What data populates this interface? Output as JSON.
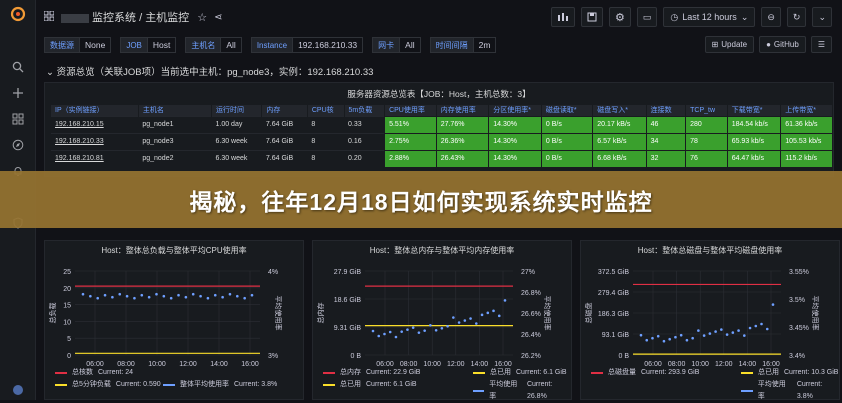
{
  "topbar": {
    "crumb_home": "",
    "crumb_suffix": "监控系统",
    "crumb_sep": "/",
    "crumb_page": "主机监控",
    "time_range": "Last 12 hours"
  },
  "vars": [
    {
      "label": "数据源",
      "value": "None"
    },
    {
      "label": "JOB",
      "value": "Host"
    },
    {
      "label": "主机名",
      "value": "All"
    },
    {
      "label": "Instance",
      "value": "192.168.210.33"
    },
    {
      "label": "网卡",
      "value": "All"
    },
    {
      "label": "时间间隔",
      "value": "2m"
    }
  ],
  "buttons": {
    "update": "Update",
    "github": "GitHub"
  },
  "section_title": "资源总览（关联JOB项）当前选中主机：pg_node3，实例：192.168.210.33",
  "table": {
    "title": "服务器资源总览表【JOB：Host，主机总数：3】",
    "headers": [
      "IP（实例链接）",
      "主机名",
      "运行时间",
      "内存",
      "CPU核",
      "5m负载",
      "CPU使用率",
      "内存使用率",
      "分区使用率*",
      "磁盘读取*",
      "磁盘写入*",
      "连接数",
      "TCP_tw",
      "下载带宽*",
      "上传带宽*"
    ],
    "rows": [
      [
        "192.168.210.15",
        "pg_node1",
        "1.00 day",
        "7.64 GiB",
        "8",
        "0.33",
        "5.51%",
        "27.76%",
        "14.30%",
        "0 B/s",
        "20.17 kB/s",
        "46",
        "280",
        "184.54 kb/s",
        "61.36 kb/s"
      ],
      [
        "192.168.210.33",
        "pg_node3",
        "6.30 week",
        "7.64 GiB",
        "8",
        "0.16",
        "2.75%",
        "26.36%",
        "14.30%",
        "0 B/s",
        "6.57 kB/s",
        "34",
        "78",
        "65.93 kb/s",
        "105.53 kb/s"
      ],
      [
        "192.168.210.81",
        "pg_node2",
        "6.30 week",
        "7.64 GiB",
        "8",
        "0.20",
        "2.88%",
        "26.43%",
        "14.30%",
        "0 B/s",
        "6.68 kB/s",
        "32",
        "76",
        "64.47 kb/s",
        "115.2 kb/s"
      ]
    ]
  },
  "banner": "揭秘，往年12月18日如何实现系统实时监控",
  "charts": [
    {
      "title": "Host：整体总负载与整体平均CPU使用率",
      "ylabel_left": "总负载",
      "ylabel_right": "平均使用率",
      "y_left_ticks": [
        "25",
        "20",
        "15",
        "10",
        "5",
        "0"
      ],
      "y_right_ticks": [
        "4%",
        "3%"
      ],
      "x_ticks": [
        "06:00",
        "08:00",
        "10:00",
        "12:00",
        "14:00",
        "16:00"
      ],
      "legend": [
        {
          "name": "总核数",
          "current": "Current: 24",
          "color": "#e02f44"
        },
        {
          "name": "总5分钟负载",
          "current": "Current: 0.590",
          "color": "#fade2a"
        },
        {
          "name": "整体平均使用率",
          "current": "Current: 3.8%",
          "color": "#6e9fff"
        }
      ]
    },
    {
      "title": "Host：整体总内存与整体平均内存使用率",
      "ylabel_left": "总内存",
      "ylabel_right": "平均使用率",
      "y_left_ticks": [
        "27.9 GiB",
        "18.6 GiB",
        "9.31 GiB",
        "0 B"
      ],
      "y_right_ticks": [
        "27%",
        "26.8%",
        "26.6%",
        "26.4%",
        "26.2%"
      ],
      "x_ticks": [
        "06:00",
        "08:00",
        "10:00",
        "12:00",
        "14:00",
        "16:00"
      ],
      "legend": [
        {
          "name": "总内存",
          "current": "Current: 22.9 GiB",
          "color": "#e02f44"
        },
        {
          "name": "总已用",
          "current": "Current: 6.1 GiB",
          "color": "#fade2a"
        },
        {
          "name": "平均使用率",
          "current": "Current: 26.8%",
          "color": "#6e9fff"
        }
      ]
    },
    {
      "title": "Host：整体总磁盘与整体平均磁盘使用率",
      "ylabel_left": "总磁盘",
      "ylabel_right": "平均使用率",
      "y_left_ticks": [
        "372.5 GiB",
        "279.4 GiB",
        "186.3 GiB",
        "93.1 GiB",
        "0 B"
      ],
      "y_right_ticks": [
        "3.55%",
        "3.5%",
        "3.45%",
        "3.4%"
      ],
      "x_ticks": [
        "06:00",
        "08:00",
        "10:00",
        "12:00",
        "14:00",
        "16:00"
      ],
      "legend": [
        {
          "name": "总磁盘量",
          "current": "Current: 293.9 GiB",
          "color": "#e02f44"
        },
        {
          "name": "总已用",
          "current": "Current: 10.3 GiB",
          "color": "#fade2a"
        },
        {
          "name": "平均使用率",
          "current": "Current: 3.8%",
          "color": "#6e9fff"
        }
      ]
    }
  ],
  "chart_data": [
    {
      "type": "line",
      "title": "Host：整体总负载与整体平均CPU使用率",
      "x": [
        "06:00",
        "08:00",
        "10:00",
        "12:00",
        "14:00",
        "16:00"
      ],
      "series": [
        {
          "name": "总核数",
          "values": [
            24,
            24,
            24,
            24,
            24,
            24
          ]
        },
        {
          "name": "总5分钟负载",
          "values": [
            0.6,
            0.6,
            0.6,
            0.6,
            0.6,
            0.59
          ]
        },
        {
          "name": "整体平均使用率",
          "values": [
            3.8,
            3.7,
            3.8,
            3.8,
            3.9,
            3.8
          ]
        }
      ]
    },
    {
      "type": "line",
      "title": "Host：整体总内存与整体平均内存使用率",
      "x": [
        "06:00",
        "08:00",
        "10:00",
        "12:00",
        "14:00",
        "16:00"
      ],
      "series": [
        {
          "name": "总内存",
          "values": [
            22.9,
            22.9,
            22.9,
            22.9,
            22.9,
            22.9
          ]
        },
        {
          "name": "总已用",
          "values": [
            6.1,
            6.1,
            6.1,
            6.1,
            6.1,
            6.1
          ]
        },
        {
          "name": "平均使用率",
          "values": [
            26.3,
            26.35,
            26.4,
            26.5,
            26.6,
            26.8
          ]
        }
      ]
    },
    {
      "type": "line",
      "title": "Host：整体总磁盘与整体平均磁盘使用率",
      "x": [
        "06:00",
        "08:00",
        "10:00",
        "12:00",
        "14:00",
        "16:00"
      ],
      "series": [
        {
          "name": "总磁盘量",
          "values": [
            293.9,
            293.9,
            293.9,
            293.9,
            293.9,
            293.9
          ]
        },
        {
          "name": "总已用",
          "values": [
            10.3,
            10.3,
            10.3,
            10.3,
            10.3,
            10.3
          ]
        },
        {
          "name": "平均使用率",
          "values": [
            3.44,
            3.44,
            3.45,
            3.45,
            3.46,
            3.5
          ]
        }
      ]
    }
  ]
}
